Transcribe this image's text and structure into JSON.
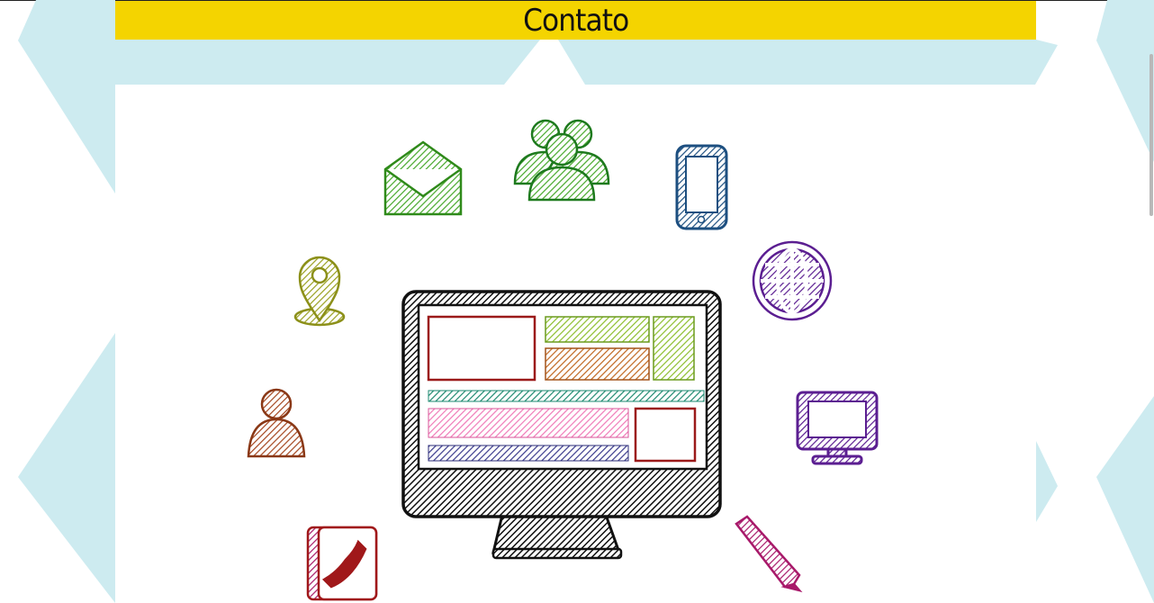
{
  "page": {
    "title": "Contato",
    "colors": {
      "title_bar": "#F4D400",
      "background_pattern": "#CDEBF0",
      "panel": "#FFFFFF"
    }
  },
  "illustration": {
    "central": "monitor-icon",
    "surrounding_icons": [
      "envelope-icon",
      "group-icon",
      "smartphone-icon",
      "globe-icon",
      "location-pin-icon",
      "user-icon",
      "desktop-icon",
      "address-book-icon",
      "pen-icon"
    ]
  }
}
